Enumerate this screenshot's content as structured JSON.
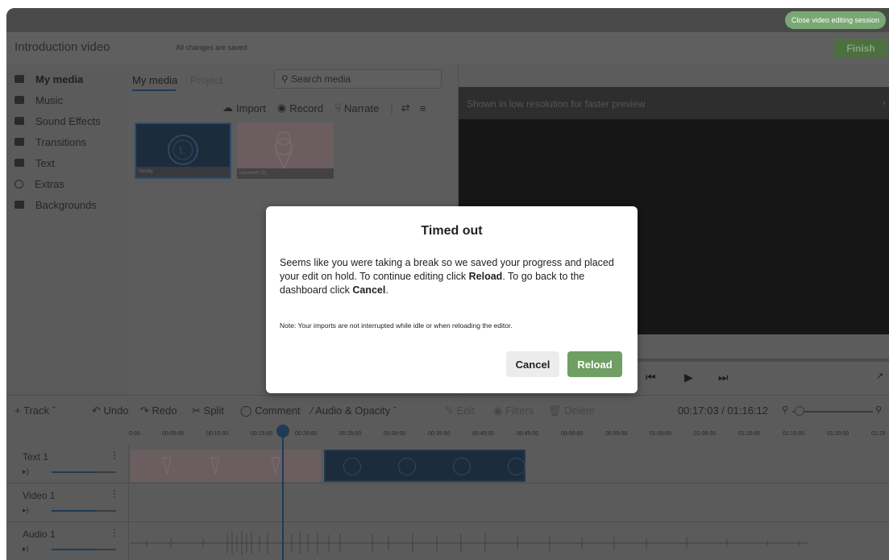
{
  "session": {
    "close_label": "Close video editing session"
  },
  "header": {
    "title": "Introduction video",
    "save_status": "All changes are saved",
    "finish_label": "Finish"
  },
  "sidebar": {
    "items": [
      {
        "label": "My media",
        "icon": "folder-icon"
      },
      {
        "label": "Music",
        "icon": "folder-icon"
      },
      {
        "label": "Sound Effects",
        "icon": "folder-icon"
      },
      {
        "label": "Transitions",
        "icon": "transition-icon"
      },
      {
        "label": "Text",
        "icon": "text-icon"
      },
      {
        "label": "Extras",
        "icon": "smiley-icon"
      },
      {
        "label": "Backgrounds",
        "icon": "background-icon"
      }
    ]
  },
  "media": {
    "tabs": [
      "My media",
      "Project"
    ],
    "search_placeholder": "Search media",
    "import_label": "Import",
    "record_label": "Record",
    "narrate_label": "Narrate",
    "thumbnails": [
      {
        "caption": "Varsity"
      },
      {
        "caption": "Icecream (2)"
      }
    ]
  },
  "preview": {
    "notice": "Shown in low resolution for faster preview"
  },
  "timeline_toolbar": {
    "track": "Track",
    "undo": "Undo",
    "redo": "Redo",
    "split": "Split",
    "comment": "Comment",
    "audio_opacity": "Audio & Opacity",
    "edit": "Edit",
    "filters": "Filters",
    "delete": "Delete",
    "timecode": "00:17:03 / 01:16:12"
  },
  "ruler": [
    "0:00",
    "00:05:00",
    "00:10:00",
    "00:15:00",
    "00:20:00",
    "00:25:00",
    "00:30:00",
    "00:35:00",
    "00:40:00",
    "00:45:00",
    "00:50:00",
    "00:55:00",
    "01:00:00",
    "01:05:00",
    "01:10:00",
    "01:15:00",
    "01:20:00",
    "01:25"
  ],
  "tracks": [
    {
      "name": "Text 1"
    },
    {
      "name": "Video 1"
    },
    {
      "name": "Audio 1"
    }
  ],
  "modal": {
    "title": "Timed out",
    "body_1": "Seems like you were taking a break so we saved your progress and placed your edit on hold. To continue editing click ",
    "body_reload": "Reload",
    "body_2": ". To go back to the dashboard click ",
    "body_cancel": "Cancel",
    "body_3": ".",
    "note": "Note: Your imports are not interrupted while idle or when reloading the editor.",
    "cancel_label": "Cancel",
    "reload_label": "Reload"
  },
  "colors": {
    "accent": "#6f9f62",
    "playhead": "#1f3b57",
    "overlay": "#5b5b5b"
  }
}
